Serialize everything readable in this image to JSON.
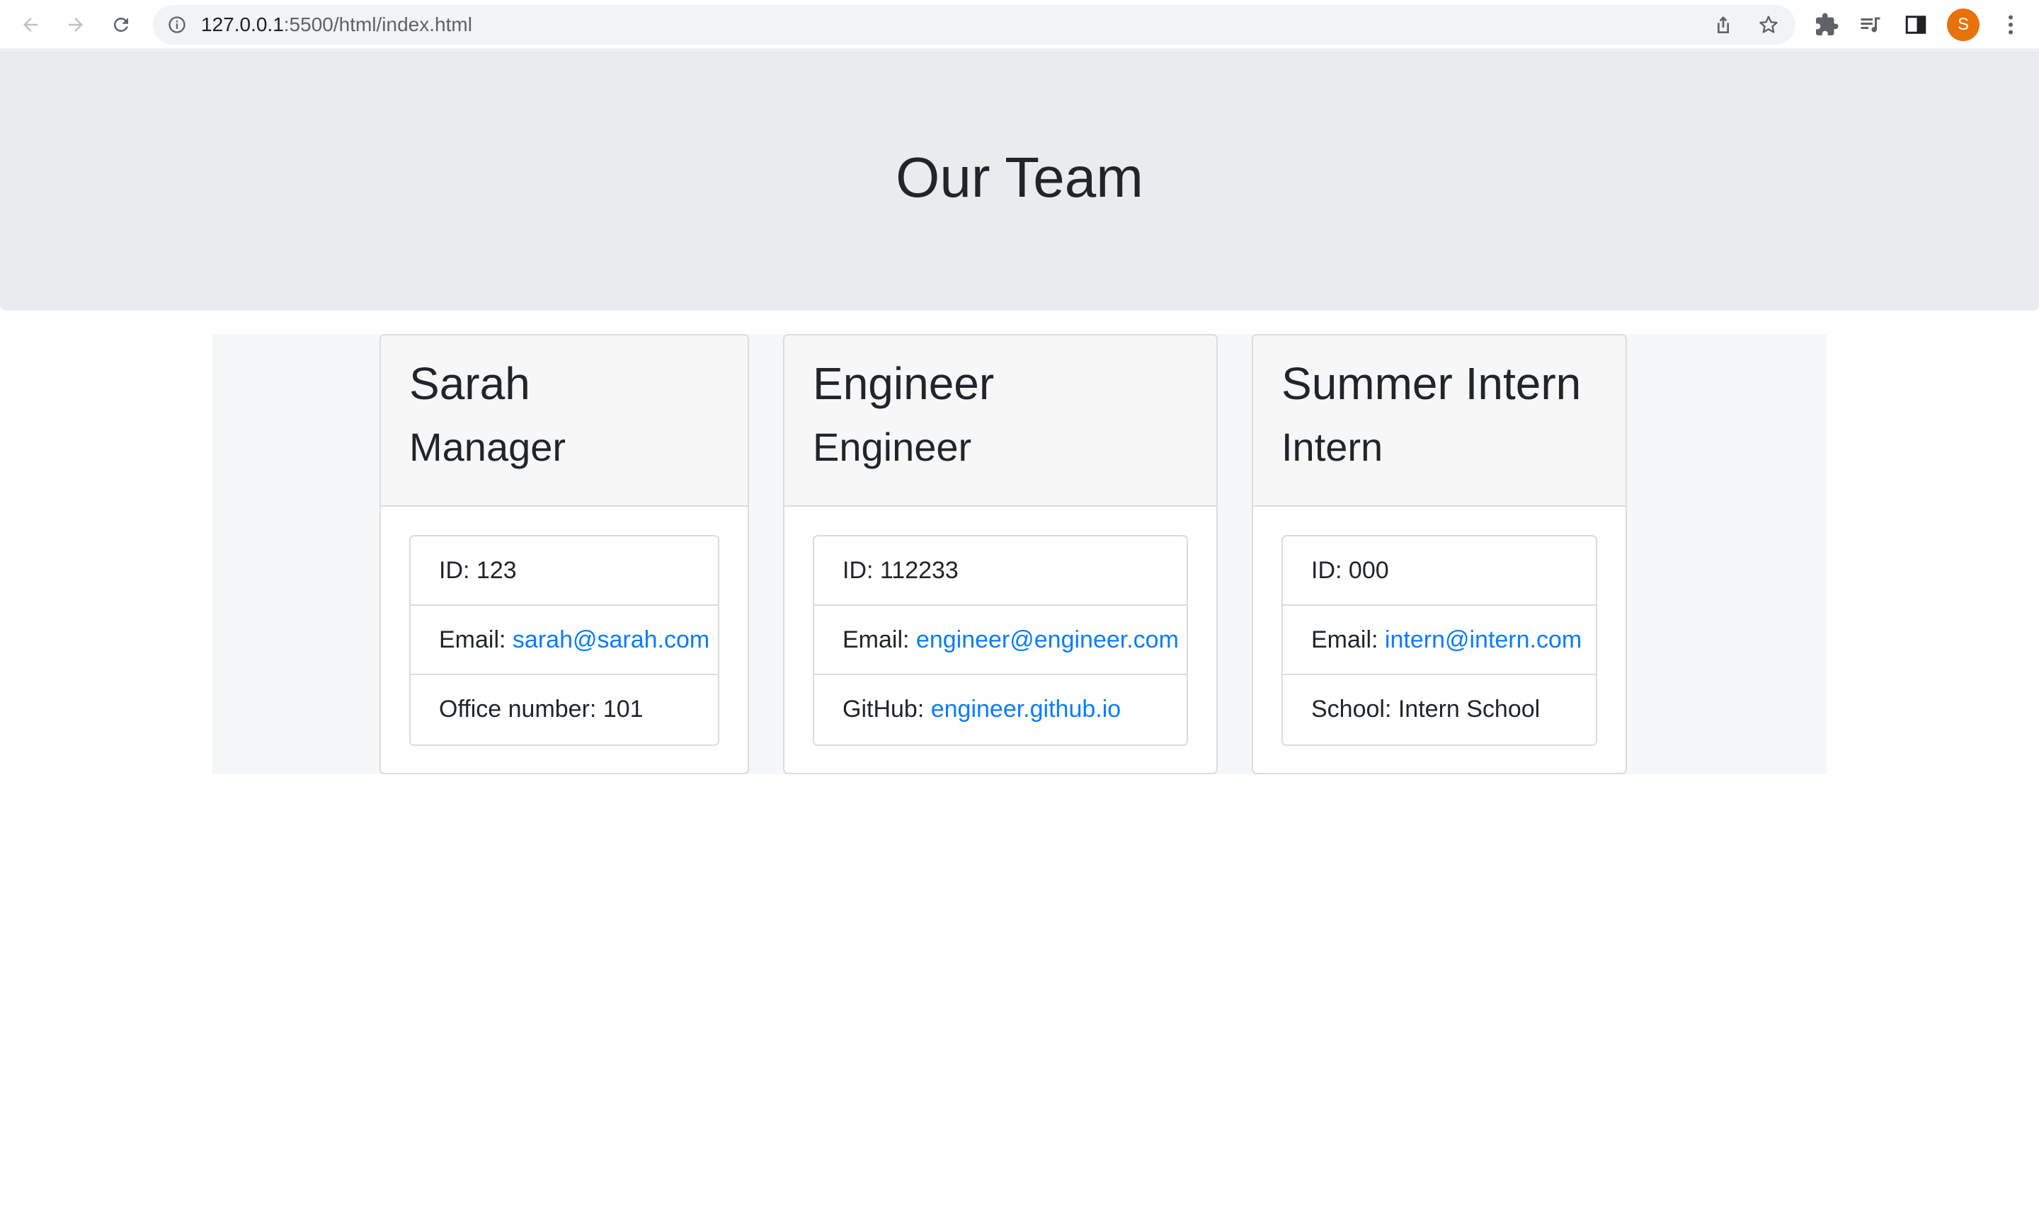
{
  "browser": {
    "url_host": "127.0.0.1",
    "url_rest": ":5500/html/index.html",
    "profile_initial": "S",
    "icons": {
      "back": "arrow-left-icon",
      "forward": "arrow-right-icon",
      "reload": "reload-icon",
      "site_info": "info-icon",
      "share": "share-icon",
      "bookmark": "star-icon",
      "extensions": "puzzle-icon",
      "media": "media-queue-icon",
      "side_panel": "side-panel-icon",
      "menu": "kebab-menu-icon"
    },
    "colors": {
      "avatar": "#e8710a"
    }
  },
  "page": {
    "title": "Our Team",
    "colors": {
      "jumbotron_bg": "#e9ecef",
      "link": "#0a7cff"
    }
  },
  "team": [
    {
      "name": "Sarah",
      "role": "Manager",
      "id_label": "ID: ",
      "id": "123",
      "email_label": "Email: ",
      "email": "sarah@sarah.com",
      "extra_label": "Office number: ",
      "extra_value": "101"
    },
    {
      "name": "Engineer",
      "role": "Engineer",
      "id_label": "ID: ",
      "id": "112233",
      "email_label": "Email: ",
      "email": "engineer@engineer.com",
      "extra_label": "GitHub: ",
      "extra_value": "engineer.github.io"
    },
    {
      "name": "Summer Intern",
      "role": "Intern",
      "id_label": "ID: ",
      "id": "000",
      "email_label": "Email: ",
      "email": "intern@intern.com",
      "extra_label": "School: ",
      "extra_value": "Intern School"
    }
  ]
}
